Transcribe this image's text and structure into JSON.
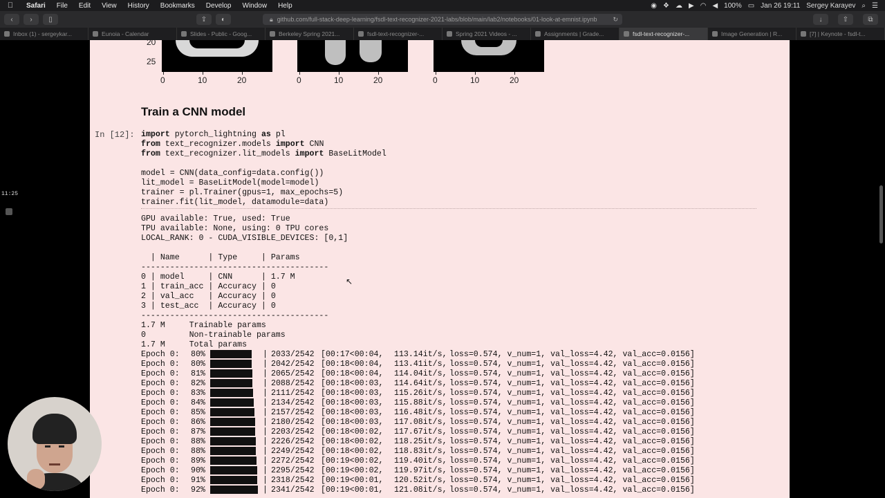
{
  "menubar": {
    "apple": "",
    "app": "Safari",
    "items": [
      "File",
      "Edit",
      "View",
      "History",
      "Bookmarks",
      "Develop",
      "Window",
      "Help"
    ],
    "battery": "100%",
    "datetime": "Jan 26  19:11",
    "user": "Sergey Karayev"
  },
  "browser": {
    "url": "github.com/full-stack-deep-learning/fsdl-text-recognizer-2021-labs/blob/main/lab2/notebooks/01-look-at-emnist.ipynb",
    "tabs": [
      {
        "label": "Inbox (1) - sergeykar...",
        "active": false
      },
      {
        "label": "Eunoia - Calendar",
        "active": false
      },
      {
        "label": "Slides - Public - Goog...",
        "active": false
      },
      {
        "label": "Berkeley Spring 2021...",
        "active": false
      },
      {
        "label": "fsdl-text-recognizer-...",
        "active": false
      },
      {
        "label": "Spring 2021 Videos - ...",
        "active": false
      },
      {
        "label": "Assignments | Grade...",
        "active": false
      },
      {
        "label": "fsdl-text-recognizer-...",
        "active": true
      },
      {
        "label": "Image Generation | R...",
        "active": false
      },
      {
        "label": "[7] | Keynote - fsdl-t...",
        "active": false
      }
    ]
  },
  "figure": {
    "y_ticks": [
      "20",
      "25"
    ],
    "x_ticks": [
      "0",
      "10",
      "20"
    ]
  },
  "notebook": {
    "heading": "Train a CNN model",
    "prompt": "In [12]:",
    "code": [
      {
        "kw": "import",
        "rest": " pytorch_lightning ",
        "kw2": "as",
        "rest2": " pl"
      },
      {
        "kw": "from",
        "rest": " text_recognizer.models ",
        "kw2": "import",
        "rest2": " CNN"
      },
      {
        "kw": "from",
        "rest": " text_recognizer.lit_models ",
        "kw2": "import",
        "rest2": " BaseLitModel"
      },
      {
        "plain": "model = CNN(data_config=data.config())"
      },
      {
        "plain": "lit_model = BaseLitModel(model=model)"
      },
      {
        "plain": "trainer = pl.Trainer(gpus=1, max_epochs=5)"
      },
      {
        "plain": "trainer.fit(lit_model, datamodule=data)"
      }
    ],
    "output": [
      "GPU available: True, used: True",
      "TPU available: None, using: 0 TPU cores",
      "LOCAL_RANK: 0 - CUDA_VISIBLE_DEVICES: [0,1]",
      "",
      "  | Name      | Type     | Params",
      "---------------------------------------",
      "0 | model     | CNN      | 1.7 M",
      "1 | train_acc | Accuracy | 0",
      "2 | val_acc   | Accuracy | 0",
      "3 | test_acc  | Accuracy | 0",
      "---------------------------------------",
      "1.7 M     Trainable params",
      "0         Non-trainable params",
      "1.7 M     Total params"
    ],
    "progress": [
      {
        "pct": "80%",
        "step": "2033/2542",
        "time": "[00:17<00:04,",
        "rate": "113.14it/s,",
        "fill": 0.8
      },
      {
        "pct": "80%",
        "step": "2042/2542",
        "time": "[00:18<00:04,",
        "rate": "113.41it/s,",
        "fill": 0.8
      },
      {
        "pct": "81%",
        "step": "2065/2542",
        "time": "[00:18<00:04,",
        "rate": "114.04it/s,",
        "fill": 0.81
      },
      {
        "pct": "82%",
        "step": "2088/2542",
        "time": "[00:18<00:03,",
        "rate": "114.64it/s,",
        "fill": 0.82
      },
      {
        "pct": "83%",
        "step": "2111/2542",
        "time": "[00:18<00:03,",
        "rate": "115.26it/s,",
        "fill": 0.83
      },
      {
        "pct": "84%",
        "step": "2134/2542",
        "time": "[00:18<00:03,",
        "rate": "115.88it/s,",
        "fill": 0.84
      },
      {
        "pct": "85%",
        "step": "2157/2542",
        "time": "[00:18<00:03,",
        "rate": "116.48it/s,",
        "fill": 0.85
      },
      {
        "pct": "86%",
        "step": "2180/2542",
        "time": "[00:18<00:03,",
        "rate": "117.08it/s,",
        "fill": 0.86
      },
      {
        "pct": "87%",
        "step": "2203/2542",
        "time": "[00:18<00:02,",
        "rate": "117.67it/s,",
        "fill": 0.87
      },
      {
        "pct": "88%",
        "step": "2226/2542",
        "time": "[00:18<00:02,",
        "rate": "118.25it/s,",
        "fill": 0.88
      },
      {
        "pct": "88%",
        "step": "2249/2542",
        "time": "[00:18<00:02,",
        "rate": "118.83it/s,",
        "fill": 0.88
      },
      {
        "pct": "89%",
        "step": "2272/2542",
        "time": "[00:19<00:02,",
        "rate": "119.40it/s,",
        "fill": 0.89
      },
      {
        "pct": "90%",
        "step": "2295/2542",
        "time": "[00:19<00:02,",
        "rate": "119.97it/s,",
        "fill": 0.9
      },
      {
        "pct": "91%",
        "step": "2318/2542",
        "time": "[00:19<00:01,",
        "rate": "120.52it/s,",
        "fill": 0.91
      },
      {
        "pct": "92%",
        "step": "2341/2542",
        "time": "[00:19<00:01,",
        "rate": "121.08it/s,",
        "fill": 0.92
      }
    ],
    "progress_prefix": "Epoch 0:",
    "progress_tail": "loss=0.574, v_num=1, val_loss=4.42, val_acc=0.0156]"
  },
  "overlay": {
    "timer": "11:25"
  },
  "colors": {
    "page_bg": "#fbe5e5",
    "bar": "#111111"
  }
}
